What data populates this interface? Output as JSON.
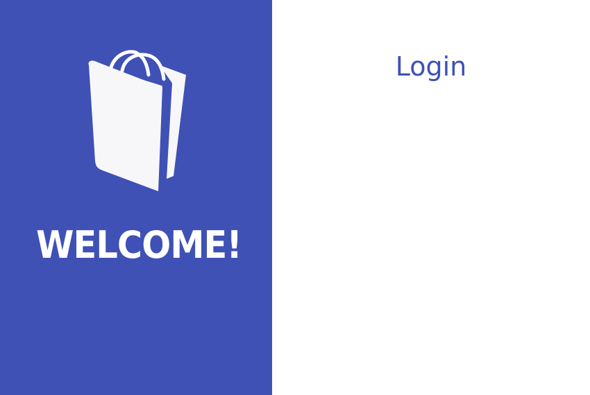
{
  "brand": {
    "welcome_text": "WELCOME!",
    "logo_icon": "shopping-bag-icon"
  },
  "login": {
    "title": "Login"
  },
  "colors": {
    "primary": "#3F51B5",
    "white": "#FFFFFF",
    "bag_fill": "#F7F7FA"
  }
}
